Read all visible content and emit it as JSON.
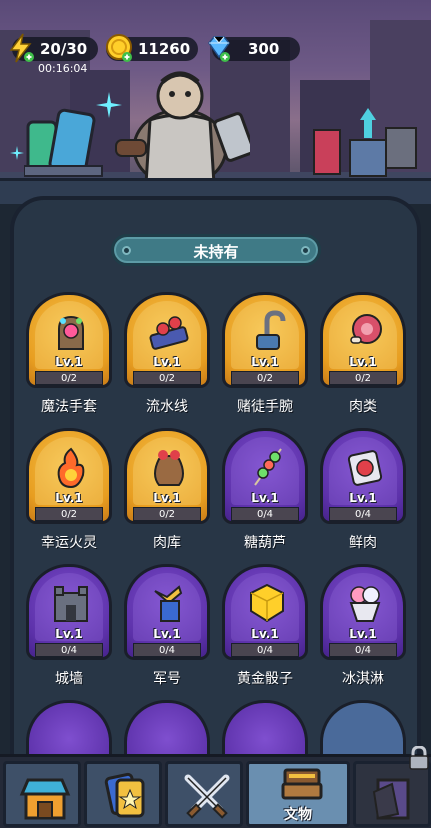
{
  "resources": {
    "energy": "20/30",
    "energy_timer": "00:16:04",
    "gold": "11260",
    "gems": "300"
  },
  "section": {
    "title": "未持有"
  },
  "items": [
    {
      "name": "魔法手套",
      "level": "Lv.1",
      "progress": "0/2",
      "rarity": "gold",
      "icon": "magic-glove-icon"
    },
    {
      "name": "流水线",
      "level": "Lv.1",
      "progress": "0/2",
      "rarity": "gold",
      "icon": "assembly-line-icon"
    },
    {
      "name": "赌徒手腕",
      "level": "Lv.1",
      "progress": "0/2",
      "rarity": "gold",
      "icon": "hook-hand-icon"
    },
    {
      "name": "肉类",
      "level": "Lv.1",
      "progress": "0/2",
      "rarity": "gold",
      "icon": "meat-icon"
    },
    {
      "name": "幸运火灵",
      "level": "Lv.1",
      "progress": "0/2",
      "rarity": "gold",
      "icon": "fire-spirit-icon"
    },
    {
      "name": "肉库",
      "level": "Lv.1",
      "progress": "0/2",
      "rarity": "gold",
      "icon": "meat-sack-icon"
    },
    {
      "name": "糖葫芦",
      "level": "Lv.1",
      "progress": "0/4",
      "rarity": "purple",
      "icon": "candied-skewer-icon"
    },
    {
      "name": "鲜肉",
      "level": "Lv.1",
      "progress": "0/4",
      "rarity": "purple",
      "icon": "fresh-meat-pack-icon"
    },
    {
      "name": "城墙",
      "level": "Lv.1",
      "progress": "0/4",
      "rarity": "purple",
      "icon": "city-wall-icon"
    },
    {
      "name": "军号",
      "level": "Lv.1",
      "progress": "0/4",
      "rarity": "purple",
      "icon": "bugle-icon"
    },
    {
      "name": "黄金骰子",
      "level": "Lv.1",
      "progress": "0/4",
      "rarity": "purple",
      "icon": "golden-dice-icon"
    },
    {
      "name": "冰淇淋",
      "level": "Lv.1",
      "progress": "0/4",
      "rarity": "purple",
      "icon": "ice-cream-icon"
    }
  ],
  "nav": {
    "tabs": [
      {
        "icon": "shop-icon",
        "label": ""
      },
      {
        "icon": "cards-icon",
        "label": ""
      },
      {
        "icon": "crossed-swords-icon",
        "label": ""
      },
      {
        "icon": "artifact-books-icon",
        "label": "文物"
      },
      {
        "icon": "locked-door-icon",
        "label": ""
      }
    ],
    "active_index": 3
  },
  "colors": {
    "gold_card": "#e79d20",
    "purple_card": "#5c31a9",
    "panel_bg": "#283646",
    "section_band": "#3f7a86"
  }
}
